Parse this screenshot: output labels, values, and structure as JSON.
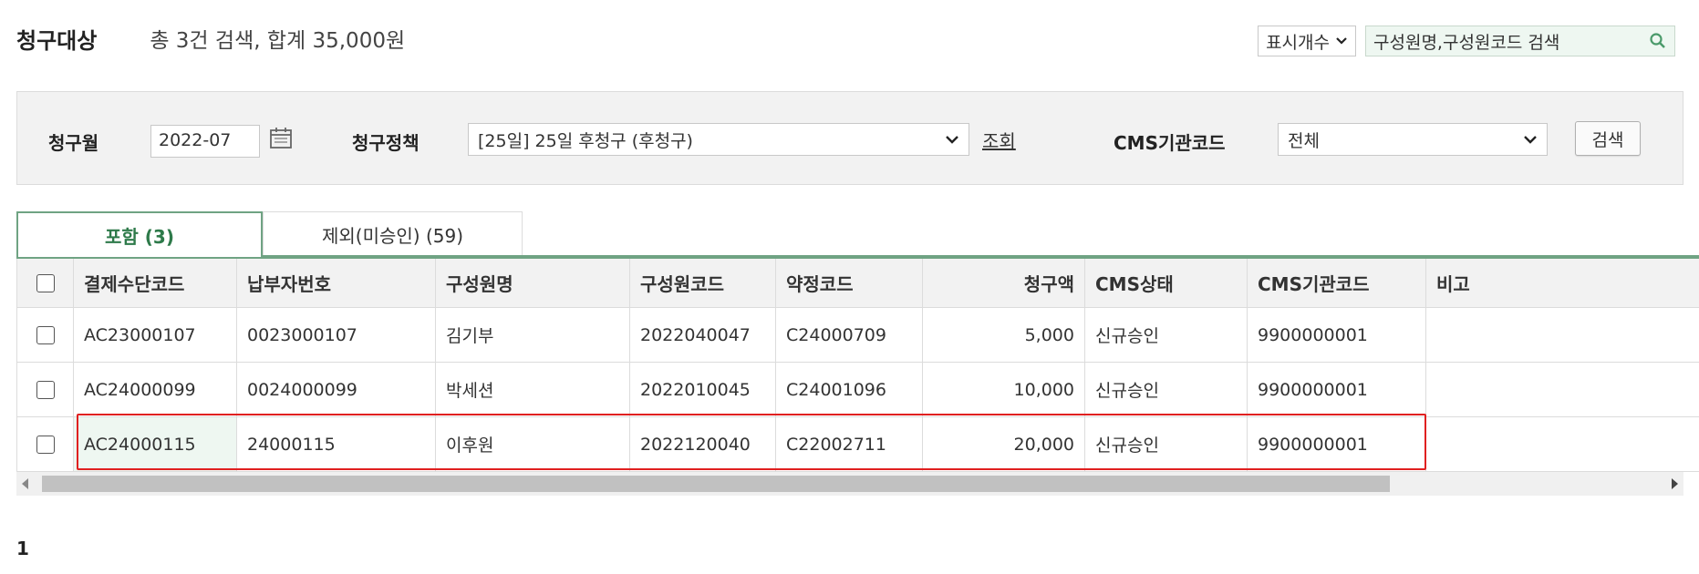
{
  "header": {
    "title": "청구대상",
    "summary": "총 3건 검색, 합계 35,000원"
  },
  "toolbar": {
    "display_count_label": "표시개수",
    "search_placeholder": "구성원명,구성원코드 검색"
  },
  "filters": {
    "billing_month_label": "청구월",
    "billing_month_value": "2022-07",
    "billing_policy_label": "청구정책",
    "billing_policy_value": "[25일] 25일 후청구 (후청구)",
    "query_link": "조회",
    "cms_code_label": "CMS기관코드",
    "cms_code_value": "전체",
    "search_button": "검색"
  },
  "tabs": [
    {
      "label": "포함 (3)",
      "active": true
    },
    {
      "label": "제외(미승인) (59)",
      "active": false
    }
  ],
  "table": {
    "columns": [
      "결제수단코드",
      "납부자번호",
      "구성원명",
      "구성원코드",
      "약정코드",
      "청구액",
      "CMS상태",
      "CMS기관코드",
      "비고"
    ],
    "rows": [
      [
        "AC23000107",
        "0023000107",
        "김기부",
        "2022040047",
        "C24000709",
        "5,000",
        "신규승인",
        "9900000001",
        ""
      ],
      [
        "AC24000099",
        "0024000099",
        "박세션",
        "2022010045",
        "C24001096",
        "10,000",
        "신규승인",
        "9900000001",
        ""
      ],
      [
        "AC24000115",
        "24000115",
        "이후원",
        "2022120040",
        "C22002711",
        "20,000",
        "신규승인",
        "9900000001",
        ""
      ]
    ]
  },
  "pagination": {
    "current": "1"
  },
  "colors": {
    "accent_green": "#6fa383",
    "highlight_red": "#e02020"
  }
}
